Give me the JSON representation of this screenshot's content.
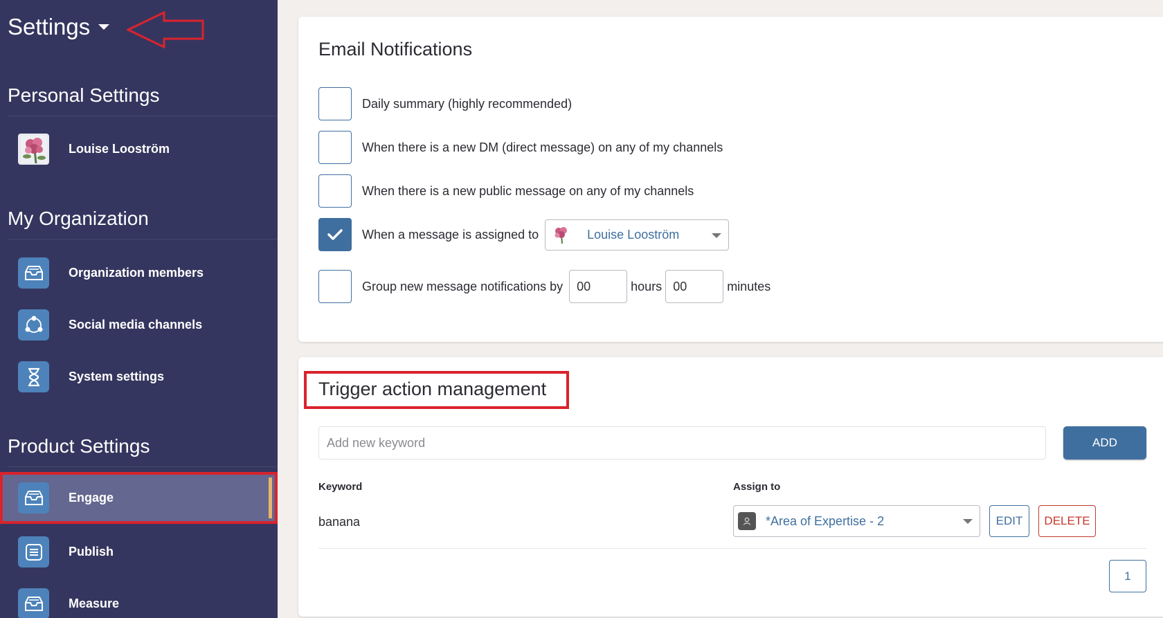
{
  "header": {
    "title": "Settings"
  },
  "sidebar": {
    "personal": {
      "title": "Personal Settings",
      "user": "Louise Looström"
    },
    "organization": {
      "title": "My Organization",
      "items": [
        {
          "label": "Organization members",
          "icon": "inbox-icon"
        },
        {
          "label": "Social media channels",
          "icon": "share-nodes-icon"
        },
        {
          "label": "System settings",
          "icon": "hourglass-icon"
        }
      ]
    },
    "product": {
      "title": "Product Settings",
      "items": [
        {
          "label": "Engage",
          "icon": "inbox-icon",
          "active": true
        },
        {
          "label": "Publish",
          "icon": "document-icon"
        },
        {
          "label": "Measure",
          "icon": "inbox-icon"
        }
      ]
    }
  },
  "email": {
    "title": "Email Notifications",
    "options": [
      {
        "label": "Daily summary (highly recommended)",
        "checked": false
      },
      {
        "label": "When there is a new DM (direct message) on any of my channels",
        "checked": false
      },
      {
        "label": "When there is a new public message on any of my channels",
        "checked": false
      },
      {
        "label": "When a message is assigned to",
        "checked": true
      },
      {
        "label": "Group new message notifications by",
        "checked": false
      }
    ],
    "assignee": "Louise Looström",
    "hours_value": "00",
    "hours_label": "hours",
    "minutes_value": "00",
    "minutes_label": "minutes"
  },
  "trigger": {
    "title": "Trigger action management",
    "keyword_placeholder": "Add new keyword",
    "add_label": "ADD",
    "columns": {
      "keyword": "Keyword",
      "assign_to": "Assign to"
    },
    "rows": [
      {
        "keyword": "banana",
        "assign_to": "*Area of Expertise - 2",
        "edit_label": "EDIT",
        "delete_label": "DELETE"
      }
    ],
    "page": "1"
  },
  "colors": {
    "sidebar_bg": "#35365f",
    "accent_blue": "#3f6f9f",
    "annotation_red": "#d9232d",
    "delete_red": "#c0392b"
  }
}
